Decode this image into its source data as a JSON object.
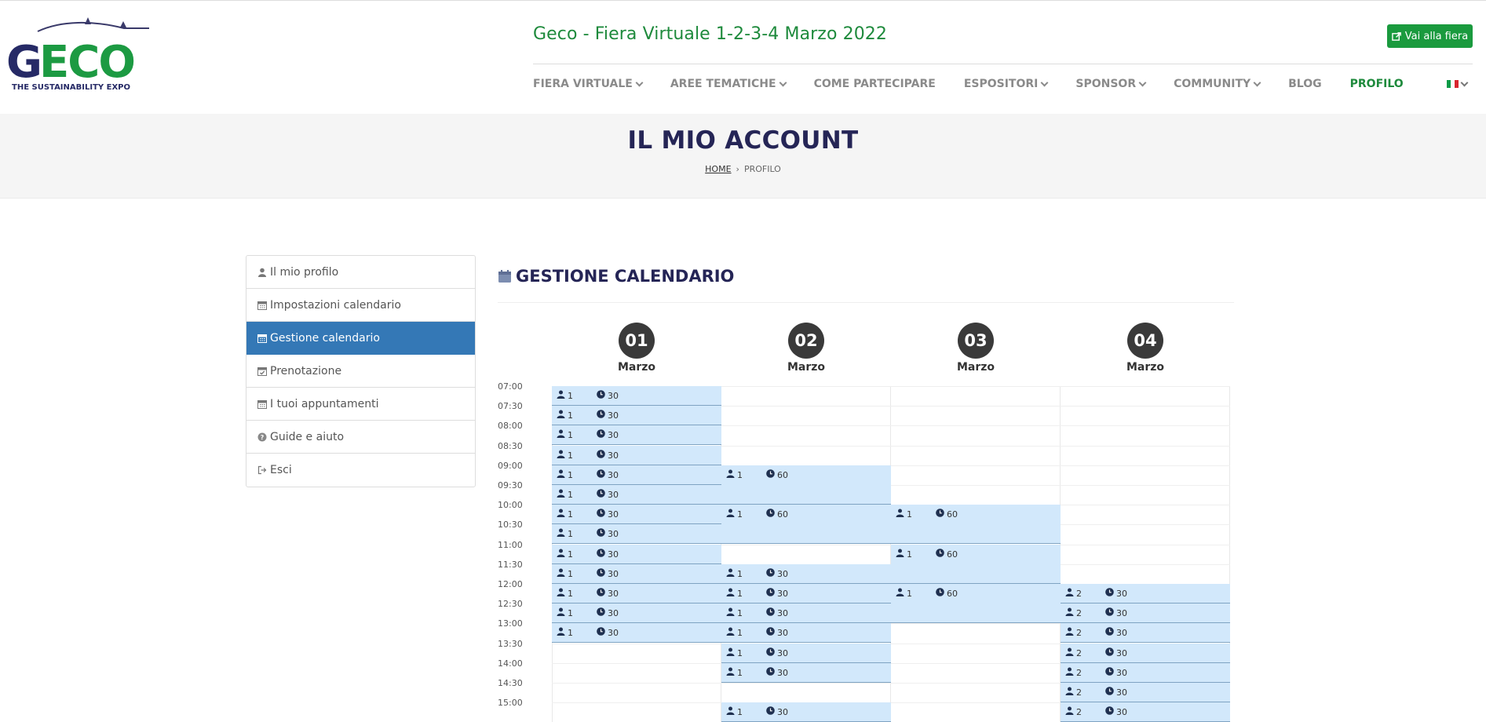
{
  "header": {
    "logo_text": "GECO",
    "logo_tagline": "THE SUSTAINABILITY EXPO",
    "site_title": "Geco - Fiera Virtuale 1-2-3-4 Marzo 2022",
    "cta_label": "Vai alla fiera",
    "nav": [
      {
        "label": "FIERA VIRTUALE",
        "dropdown": true,
        "active": false
      },
      {
        "label": "AREE TEMATICHE",
        "dropdown": true,
        "active": false
      },
      {
        "label": "COME PARTECIPARE",
        "dropdown": false,
        "active": false
      },
      {
        "label": "ESPOSITORI",
        "dropdown": true,
        "active": false
      },
      {
        "label": "SPONSOR",
        "dropdown": true,
        "active": false
      },
      {
        "label": "COMMUNITY",
        "dropdown": true,
        "active": false
      },
      {
        "label": "BLOG",
        "dropdown": false,
        "active": false
      },
      {
        "label": "PROFILO",
        "dropdown": false,
        "active": true
      }
    ],
    "language_flag": "italy-flag-icon"
  },
  "banner": {
    "title": "IL MIO ACCOUNT",
    "breadcrumb_home": "HOME",
    "breadcrumb_current": "PROFILO"
  },
  "sidebar": {
    "items": [
      {
        "label": "Il mio profilo",
        "icon": "user-icon",
        "active": false
      },
      {
        "label": "Impostazioni calendario",
        "icon": "calendar-icon",
        "active": false
      },
      {
        "label": "Gestione calendario",
        "icon": "calendar-icon",
        "active": true
      },
      {
        "label": "Prenotazione",
        "icon": "calendar-check-icon",
        "active": false
      },
      {
        "label": "I tuoi appuntamenti",
        "icon": "calendar-icon",
        "active": false
      },
      {
        "label": "Guide e aiuto",
        "icon": "question-circle-icon",
        "active": false
      },
      {
        "label": "Esci",
        "icon": "sign-out-icon",
        "active": false
      }
    ]
  },
  "main": {
    "title": "GESTIONE CALENDARIO",
    "days": [
      {
        "num": "01",
        "month": "Marzo"
      },
      {
        "num": "02",
        "month": "Marzo"
      },
      {
        "num": "03",
        "month": "Marzo"
      },
      {
        "num": "04",
        "month": "Marzo"
      }
    ],
    "times": [
      "07:00",
      "07:30",
      "08:00",
      "08:30",
      "09:00",
      "09:30",
      "10:00",
      "10:30",
      "11:00",
      "11:30",
      "12:00",
      "12:30",
      "13:00",
      "13:30",
      "14:00",
      "14:30",
      "15:00"
    ],
    "slots": [
      {
        "day": 1,
        "start": "07:00",
        "end": "07:30",
        "capacity": "1",
        "duration": "30"
      },
      {
        "day": 1,
        "start": "07:30",
        "end": "08:00",
        "capacity": "1",
        "duration": "30"
      },
      {
        "day": 1,
        "start": "08:00",
        "end": "08:30",
        "capacity": "1",
        "duration": "30"
      },
      {
        "day": 1,
        "start": "08:30",
        "end": "09:00",
        "capacity": "1",
        "duration": "30"
      },
      {
        "day": 1,
        "start": "09:00",
        "end": "09:30",
        "capacity": "1",
        "duration": "30"
      },
      {
        "day": 1,
        "start": "09:30",
        "end": "10:00",
        "capacity": "1",
        "duration": "30"
      },
      {
        "day": 1,
        "start": "10:00",
        "end": "10:30",
        "capacity": "1",
        "duration": "30"
      },
      {
        "day": 1,
        "start": "10:30",
        "end": "11:00",
        "capacity": "1",
        "duration": "30"
      },
      {
        "day": 1,
        "start": "11:00",
        "end": "11:30",
        "capacity": "1",
        "duration": "30"
      },
      {
        "day": 1,
        "start": "11:30",
        "end": "12:00",
        "capacity": "1",
        "duration": "30"
      },
      {
        "day": 1,
        "start": "12:00",
        "end": "12:30",
        "capacity": "1",
        "duration": "30"
      },
      {
        "day": 1,
        "start": "12:30",
        "end": "13:00",
        "capacity": "1",
        "duration": "30"
      },
      {
        "day": 1,
        "start": "13:00",
        "end": "13:30",
        "capacity": "1",
        "duration": "30"
      },
      {
        "day": 2,
        "start": "09:00",
        "end": "10:00",
        "capacity": "1",
        "duration": "60"
      },
      {
        "day": 2,
        "start": "10:00",
        "end": "11:00",
        "capacity": "1",
        "duration": "60"
      },
      {
        "day": 2,
        "start": "11:30",
        "end": "12:00",
        "capacity": "1",
        "duration": "30"
      },
      {
        "day": 2,
        "start": "12:00",
        "end": "12:30",
        "capacity": "1",
        "duration": "30"
      },
      {
        "day": 2,
        "start": "12:30",
        "end": "13:00",
        "capacity": "1",
        "duration": "30"
      },
      {
        "day": 2,
        "start": "13:00",
        "end": "13:30",
        "capacity": "1",
        "duration": "30"
      },
      {
        "day": 2,
        "start": "13:30",
        "end": "14:00",
        "capacity": "1",
        "duration": "30"
      },
      {
        "day": 2,
        "start": "14:00",
        "end": "14:30",
        "capacity": "1",
        "duration": "30"
      },
      {
        "day": 2,
        "start": "15:00",
        "end": "15:30",
        "capacity": "1",
        "duration": "30"
      },
      {
        "day": 3,
        "start": "10:00",
        "end": "11:00",
        "capacity": "1",
        "duration": "60"
      },
      {
        "day": 3,
        "start": "11:00",
        "end": "12:00",
        "capacity": "1",
        "duration": "60"
      },
      {
        "day": 3,
        "start": "12:00",
        "end": "13:00",
        "capacity": "1",
        "duration": "60"
      },
      {
        "day": 4,
        "start": "12:00",
        "end": "12:30",
        "capacity": "2",
        "duration": "30"
      },
      {
        "day": 4,
        "start": "12:30",
        "end": "13:00",
        "capacity": "2",
        "duration": "30"
      },
      {
        "day": 4,
        "start": "13:00",
        "end": "13:30",
        "capacity": "2",
        "duration": "30"
      },
      {
        "day": 4,
        "start": "13:30",
        "end": "14:00",
        "capacity": "2",
        "duration": "30"
      },
      {
        "day": 4,
        "start": "14:00",
        "end": "14:30",
        "capacity": "2",
        "duration": "30"
      },
      {
        "day": 4,
        "start": "14:30",
        "end": "15:00",
        "capacity": "2",
        "duration": "30"
      },
      {
        "day": 4,
        "start": "15:00",
        "end": "15:30",
        "capacity": "2",
        "duration": "30"
      }
    ]
  },
  "colors": {
    "brand_green": "#1e8a3c",
    "brand_navy": "#252556",
    "active_blue": "#3478b6",
    "slot_fill": "#d2e8fb"
  }
}
